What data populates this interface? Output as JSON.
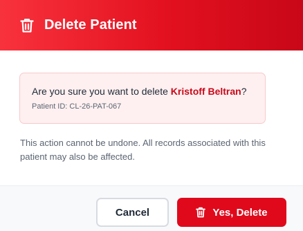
{
  "dialog": {
    "title": "Delete Patient",
    "title_icon": "trash-icon",
    "confirm_prefix": "Are you sure you want to delete ",
    "patient_name": "Kristoff Beltran",
    "confirm_suffix": "?",
    "patient_id_label": "Patient ID: CL-26-PAT-067",
    "warning_text": "This action cannot be undone. All records associated with this patient may also be affected."
  },
  "buttons": {
    "cancel_label": "Cancel",
    "delete_label": "Yes, Delete",
    "delete_icon": "trash-icon"
  },
  "colors": {
    "header_gradient_start": "#f8323d",
    "header_gradient_end": "#c80718",
    "danger": "#e0091c",
    "patient_name": "#c8091a",
    "warning_bg": "#fef0f0",
    "warning_border": "#f8c9cc"
  }
}
